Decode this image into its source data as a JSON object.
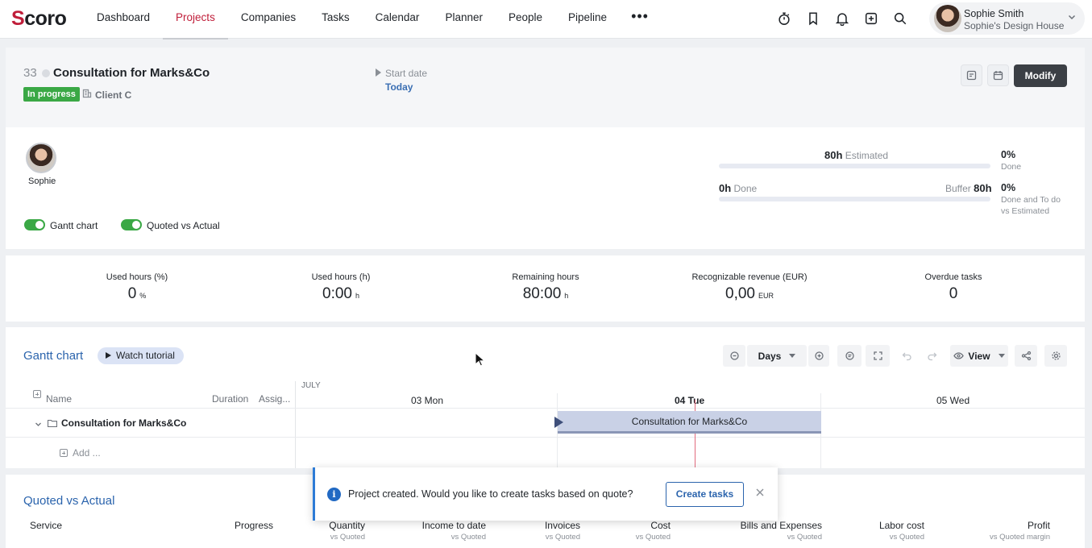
{
  "app": {
    "logo_initial": "S",
    "logo_rest": "coro"
  },
  "nav": {
    "items": [
      "Dashboard",
      "Projects",
      "Companies",
      "Tasks",
      "Calendar",
      "Planner",
      "People",
      "Pipeline"
    ],
    "active": "Projects",
    "more": "•••"
  },
  "user": {
    "name": "Sophie Smith",
    "company": "Sophie's Design House"
  },
  "project": {
    "number": "33",
    "title": "Consultation for Marks&Co",
    "status": "In progress",
    "client": "Client C",
    "start_label": "Start date",
    "start_value": "Today",
    "modify_label": "Modify"
  },
  "team": {
    "member": "Sophie"
  },
  "toggles": {
    "gantt": "Gantt chart",
    "quoted": "Quoted vs Actual"
  },
  "hours": {
    "estimated_value": "80h",
    "estimated_label": "Estimated",
    "done_value": "0h",
    "done_label": "Done",
    "buffer_label": "Buffer",
    "buffer_value": "80h",
    "pct_done": "0%",
    "pct_done_label": "Done",
    "pct_todo": "0%",
    "pct_todo_label_1": "Done and To do",
    "pct_todo_label_2": "vs Estimated",
    "done_fraction": 0
  },
  "metrics": [
    {
      "label": "Used hours (%)",
      "value": "0",
      "unit": "%"
    },
    {
      "label": "Used hours (h)",
      "value": "0:00",
      "unit": "h"
    },
    {
      "label": "Remaining hours",
      "value": "80:00",
      "unit": "h"
    },
    {
      "label": "Recognizable revenue (EUR)",
      "value": "0,00",
      "unit": "EUR"
    },
    {
      "label": "Overdue tasks",
      "value": "0",
      "unit": ""
    }
  ],
  "gantt": {
    "title": "Gantt chart",
    "watch": "Watch tutorial",
    "scale": "Days",
    "view": "View",
    "col_name": "Name",
    "col_duration": "Duration",
    "col_assign": "Assig...",
    "month": "JULY",
    "days": [
      "03 Mon",
      "04 Tue",
      "05 Wed"
    ],
    "task": "Consultation for Marks&Co",
    "add": "Add ..."
  },
  "qa": {
    "title": "Quoted vs Actual",
    "service": "Service",
    "progress": "Progress",
    "cols": [
      {
        "label": "Quantity",
        "sub": "vs Quoted"
      },
      {
        "label": "Income to date",
        "sub": "vs Quoted"
      },
      {
        "label": "Invoices",
        "sub": "vs Quoted"
      },
      {
        "label": "Cost",
        "sub": "vs Quoted"
      },
      {
        "label": "Bills and Expenses",
        "sub": "vs Quoted"
      },
      {
        "label": "Labor cost",
        "sub": "vs Quoted"
      },
      {
        "label": "Profit",
        "sub": "vs Quoted margin"
      }
    ]
  },
  "toast": {
    "icon": "i",
    "message": "Project created. Would you like to create tasks based on quote?",
    "button": "Create tasks"
  },
  "colors": {
    "brand": "#c01e3a",
    "accent": "#2b64ad",
    "success": "#3aa845",
    "dark_button": "#3b3f45"
  },
  "icons": [
    "stopwatch-icon",
    "bookmark-icon",
    "bell-icon",
    "plus-square-icon",
    "search-icon",
    "chevron-down-icon",
    "building-icon",
    "info-icon",
    "close-icon",
    "eye-icon",
    "share-icon",
    "gear-icon",
    "undo-icon",
    "redo-icon"
  ]
}
